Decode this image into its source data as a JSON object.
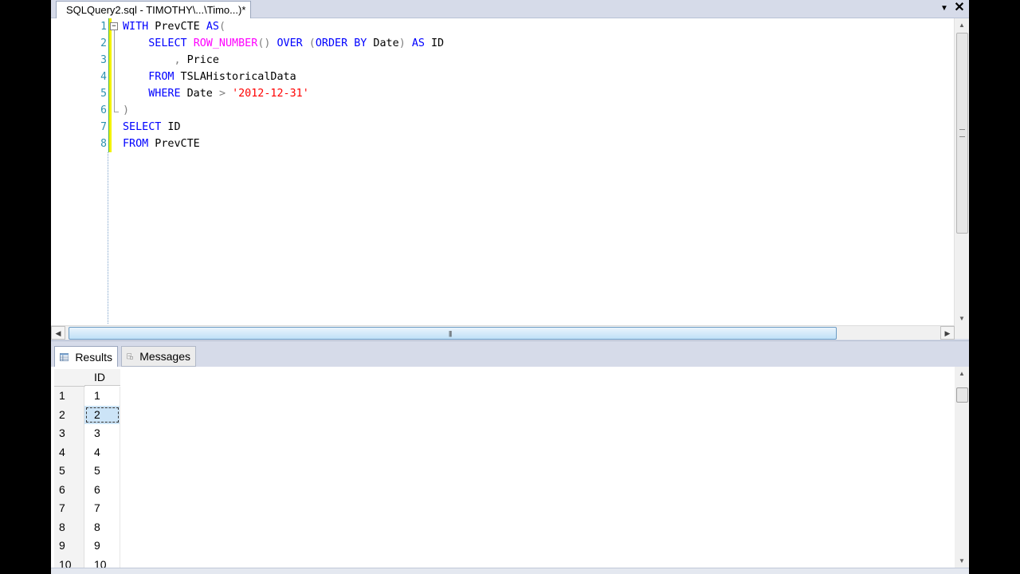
{
  "tab": {
    "title": "SQLQuery2.sql - TIMOTHY\\...\\Timo...)*"
  },
  "editor": {
    "lines": [
      {
        "num": "1",
        "tokens": [
          {
            "t": "WITH",
            "c": "kw"
          },
          {
            "t": " PrevCTE ",
            "c": ""
          },
          {
            "t": "AS",
            "c": "kw"
          },
          {
            "t": "(",
            "c": "gray"
          }
        ]
      },
      {
        "num": "2",
        "tokens": [
          {
            "t": "    ",
            "c": ""
          },
          {
            "t": "SELECT",
            "c": "kw"
          },
          {
            "t": " ",
            "c": ""
          },
          {
            "t": "ROW_NUMBER",
            "c": "fn"
          },
          {
            "t": "()",
            "c": "gray"
          },
          {
            "t": " ",
            "c": ""
          },
          {
            "t": "OVER",
            "c": "kw"
          },
          {
            "t": " (",
            "c": "gray"
          },
          {
            "t": "ORDER BY",
            "c": "kw"
          },
          {
            "t": " Date",
            "c": ""
          },
          {
            "t": ")",
            "c": "gray"
          },
          {
            "t": " ",
            "c": ""
          },
          {
            "t": "AS",
            "c": "kw"
          },
          {
            "t": " ID",
            "c": ""
          }
        ]
      },
      {
        "num": "3",
        "tokens": [
          {
            "t": "        ",
            "c": ""
          },
          {
            "t": ",",
            "c": "gray"
          },
          {
            "t": " Price",
            "c": ""
          }
        ]
      },
      {
        "num": "4",
        "tokens": [
          {
            "t": "    ",
            "c": ""
          },
          {
            "t": "FROM",
            "c": "kw"
          },
          {
            "t": " TSLAHistoricalData",
            "c": ""
          }
        ]
      },
      {
        "num": "5",
        "tokens": [
          {
            "t": "    ",
            "c": ""
          },
          {
            "t": "WHERE",
            "c": "kw"
          },
          {
            "t": " Date ",
            "c": ""
          },
          {
            "t": ">",
            "c": "gray"
          },
          {
            "t": " ",
            "c": ""
          },
          {
            "t": "'2012-12-31'",
            "c": "str"
          }
        ]
      },
      {
        "num": "6",
        "tokens": [
          {
            "t": ")",
            "c": "gray"
          }
        ]
      },
      {
        "num": "7",
        "tokens": [
          {
            "t": "SELECT",
            "c": "kw"
          },
          {
            "t": " ID",
            "c": ""
          }
        ]
      },
      {
        "num": "8",
        "tokens": [
          {
            "t": "FROM",
            "c": "kw"
          },
          {
            "t": " PrevCTE",
            "c": ""
          }
        ]
      }
    ]
  },
  "results_tabs": {
    "results_label": "Results",
    "messages_label": "Messages"
  },
  "grid": {
    "column_header": "ID",
    "selected_row": 2,
    "rows": [
      {
        "num": "1",
        "id": "1"
      },
      {
        "num": "2",
        "id": "2"
      },
      {
        "num": "3",
        "id": "3"
      },
      {
        "num": "4",
        "id": "4"
      },
      {
        "num": "5",
        "id": "5"
      },
      {
        "num": "6",
        "id": "6"
      },
      {
        "num": "7",
        "id": "7"
      },
      {
        "num": "8",
        "id": "8"
      },
      {
        "num": "9",
        "id": "9"
      },
      {
        "num": "10",
        "id": "10"
      }
    ]
  }
}
